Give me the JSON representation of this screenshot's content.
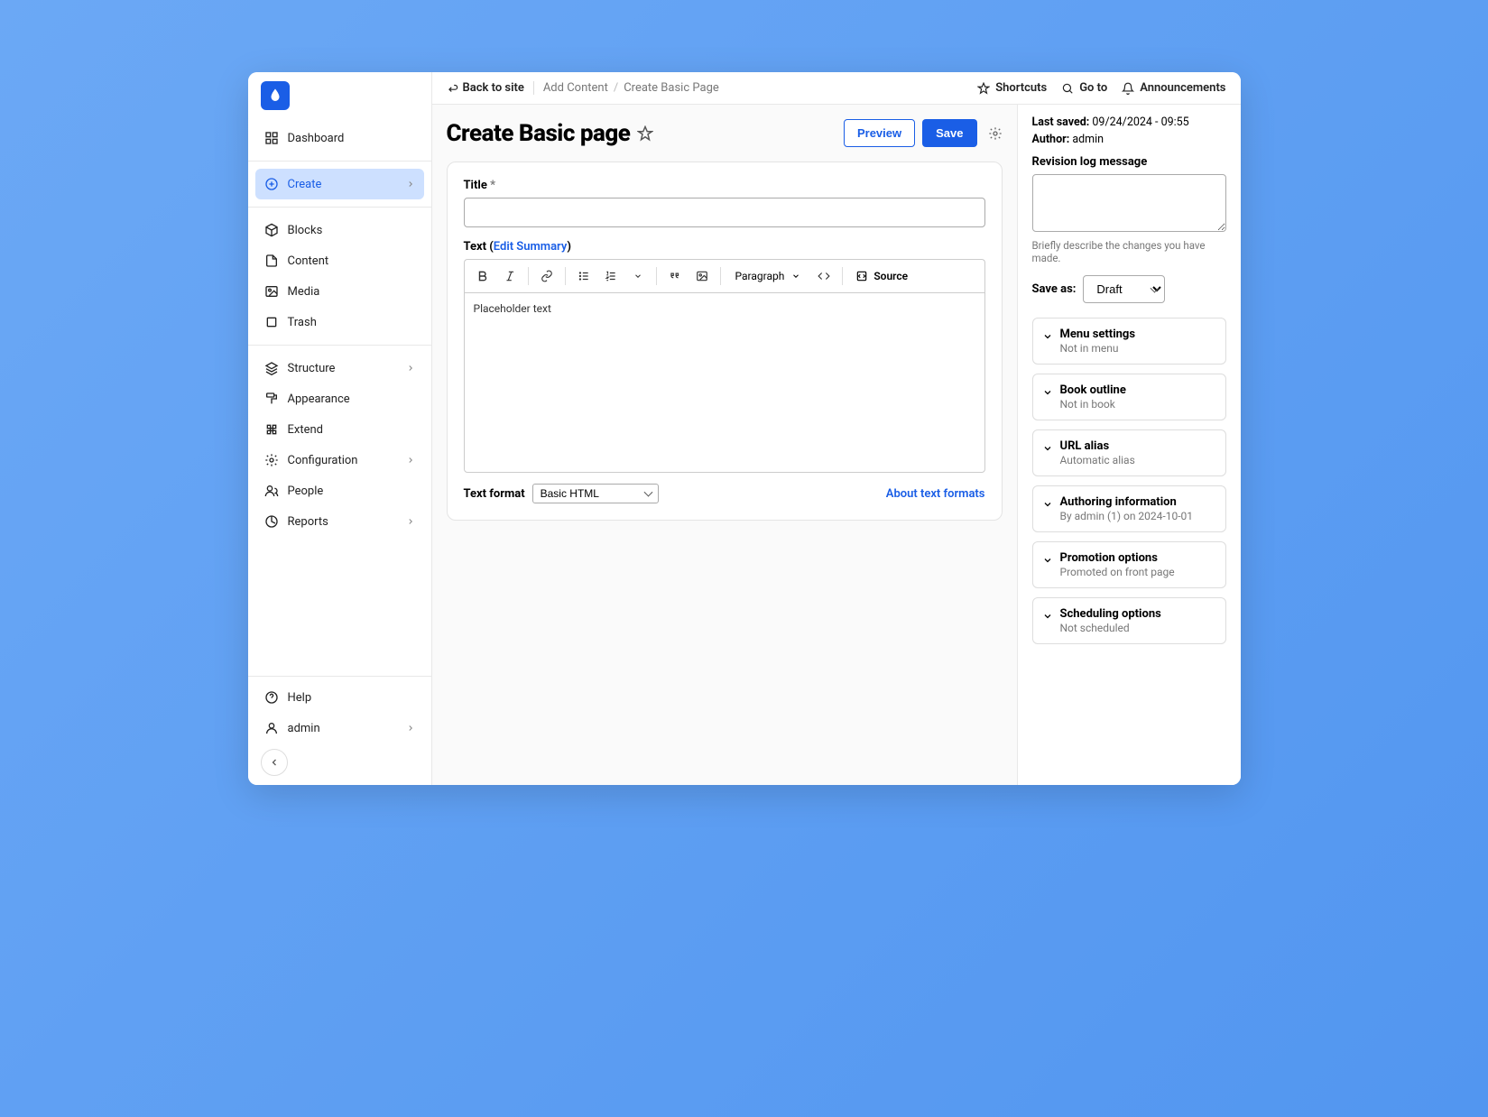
{
  "sidebar": {
    "items": [
      {
        "label": "Dashboard",
        "icon": "grid"
      },
      {
        "label": "Create",
        "icon": "plus-circle",
        "active": true,
        "expandable": true
      }
    ],
    "group2": [
      {
        "label": "Blocks",
        "icon": "cube"
      },
      {
        "label": "Content",
        "icon": "file"
      },
      {
        "label": "Media",
        "icon": "image"
      },
      {
        "label": "Trash",
        "icon": "square"
      }
    ],
    "group3": [
      {
        "label": "Structure",
        "icon": "layers",
        "expandable": true
      },
      {
        "label": "Appearance",
        "icon": "paint"
      },
      {
        "label": "Extend",
        "icon": "puzzle"
      },
      {
        "label": "Configuration",
        "icon": "gear",
        "expandable": true
      },
      {
        "label": "People",
        "icon": "users"
      },
      {
        "label": "Reports",
        "icon": "report",
        "expandable": true
      }
    ],
    "bottom": [
      {
        "label": "Help",
        "icon": "help"
      },
      {
        "label": "admin",
        "icon": "user",
        "expandable": true
      }
    ]
  },
  "topbar": {
    "back": "Back to site",
    "breadcrumb": [
      "Add Content",
      "Create Basic Page"
    ],
    "shortcuts": "Shortcuts",
    "goto": "Go to",
    "announcements": "Announcements"
  },
  "page": {
    "title": "Create Basic page",
    "preview": "Preview",
    "save": "Save"
  },
  "form": {
    "title_label": "Title",
    "title_value": "",
    "text_label": "Text",
    "edit_summary": "Edit Summary",
    "placeholder": "Placeholder text",
    "paragraph": "Paragraph",
    "source": "Source",
    "text_format_label": "Text  format",
    "text_format_value": "Basic HTML",
    "about_link": "About text formats"
  },
  "meta": {
    "last_saved_label": "Last saved:",
    "last_saved_value": "09/24/2024 - 09:55",
    "author_label": "Author:",
    "author_value": "admin",
    "revision_label": "Revision log message",
    "revision_help": "Briefly describe the changes you have made.",
    "save_as_label": "Save as:",
    "save_as_value": "Draft",
    "accordions": [
      {
        "title": "Menu settings",
        "sub": "Not in menu"
      },
      {
        "title": "Book outline",
        "sub": "Not in book"
      },
      {
        "title": "URL alias",
        "sub": "Automatic alias"
      },
      {
        "title": "Authoring information",
        "sub": "By admin (1) on 2024-10-01"
      },
      {
        "title": "Promotion options",
        "sub": "Promoted on front page"
      },
      {
        "title": "Scheduling options",
        "sub": "Not scheduled"
      }
    ]
  }
}
